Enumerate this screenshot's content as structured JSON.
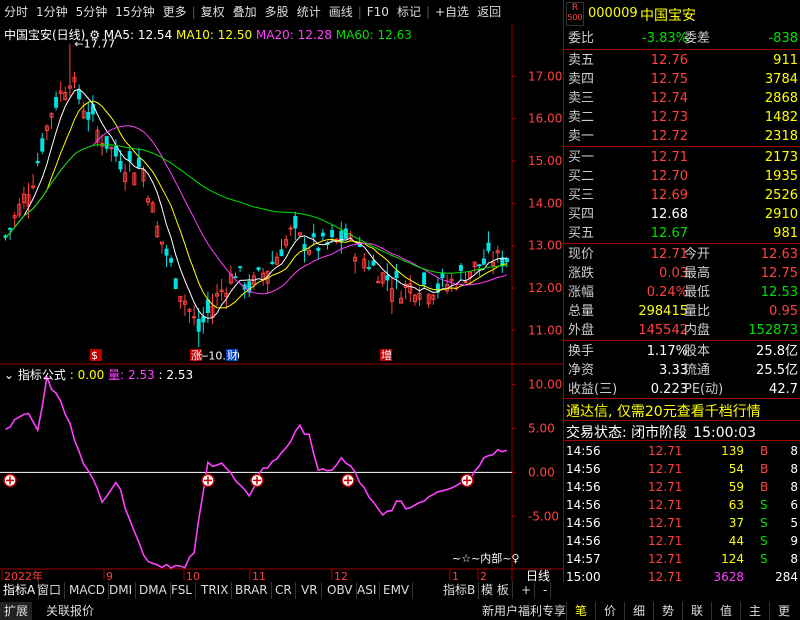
{
  "toolbar": {
    "items": [
      "分时",
      "1分钟",
      "5分钟",
      "15分钟",
      "更多",
      "复权",
      "叠加",
      "多股",
      "统计",
      "画线",
      "F10",
      "标记",
      "+自选",
      "返回"
    ]
  },
  "chart_header": {
    "title": "中国宝安(日线)",
    "ma5": "MA5: 12.54",
    "ma10": "MA10: 12.50",
    "ma20": "MA20: 12.28",
    "ma60": "MA60: 12.63"
  },
  "indicator_header": {
    "name": "指标公式",
    "v1": ": 0.00",
    "v2": "量: 2.53",
    "v3": ": 2.53"
  },
  "chart_data": [
    {
      "type": "line",
      "name": "price",
      "yaxis_ticks": [
        "17.00",
        "16.00",
        "15.00",
        "14.00",
        "13.00",
        "12.00",
        "11.00"
      ],
      "ylim": [
        10.6,
        17.77
      ],
      "annotations": [
        "17.77",
        "10.60"
      ],
      "markers": [
        "$",
        "涨",
        "财",
        "增"
      ]
    },
    {
      "type": "line",
      "name": "indicator",
      "yaxis_ticks": [
        "10.00",
        "5.00",
        "0.00",
        "-5.00"
      ],
      "ylim": [
        -11,
        11
      ]
    }
  ],
  "date_axis": {
    "labels": [
      "2022年",
      "9",
      "10",
      "11",
      "12",
      "1",
      "2"
    ],
    "period": "日线"
  },
  "badge_r": "R",
  "badge_num": "500",
  "stock": {
    "code": "000009",
    "name": "中国宝安"
  },
  "weibi": {
    "label": "委比",
    "value": "-3.83%",
    "label2": "委差",
    "value2": "-838"
  },
  "asks": [
    {
      "label": "卖五",
      "price": "12.76",
      "vol": "911"
    },
    {
      "label": "卖四",
      "price": "12.75",
      "vol": "3784"
    },
    {
      "label": "卖三",
      "price": "12.74",
      "vol": "2868"
    },
    {
      "label": "卖二",
      "price": "12.73",
      "vol": "1482"
    },
    {
      "label": "卖一",
      "price": "12.72",
      "vol": "2318"
    }
  ],
  "bids": [
    {
      "label": "买一",
      "price": "12.71",
      "vol": "2173"
    },
    {
      "label": "买二",
      "price": "12.70",
      "vol": "1935"
    },
    {
      "label": "买三",
      "price": "12.69",
      "vol": "2526"
    },
    {
      "label": "买四",
      "price": "12.68",
      "vol": "2910"
    },
    {
      "label": "买五",
      "price": "12.67",
      "vol": "981"
    }
  ],
  "quote": [
    {
      "l1": "现价",
      "v1": "12.71",
      "l2": "今开",
      "v2": "12.63"
    },
    {
      "l1": "涨跌",
      "v1": "0.03",
      "l2": "最高",
      "v2": "12.75"
    },
    {
      "l1": "涨幅",
      "v1": "0.24%",
      "l2": "最低",
      "v2": "12.53"
    },
    {
      "l1": "总量",
      "v1": "298415",
      "l2": "量比",
      "v2": "0.95"
    },
    {
      "l1": "外盘",
      "v1": "145542",
      "l2": "内盘",
      "v2": "152873"
    }
  ],
  "stats": [
    {
      "l1": "换手",
      "v1": "1.17%",
      "l2": "股本",
      "v2": "25.8亿"
    },
    {
      "l1": "净资",
      "v1": "3.33",
      "l2": "流通",
      "v2": "25.5亿"
    },
    {
      "l1": "收益(三)",
      "v1": "0.223",
      "l2": "PE(动)",
      "v2": "42.7"
    }
  ],
  "promo": "通达信, 仅需20元查看千档行情",
  "trade_status": {
    "label": "交易状态: 闭市阶段",
    "time": "15:00:03"
  },
  "ticks": [
    {
      "time": "14:56",
      "price": "12.71",
      "vol": "139",
      "side": "B",
      "n": "8"
    },
    {
      "time": "14:56",
      "price": "12.71",
      "vol": "54",
      "side": "B",
      "n": "8"
    },
    {
      "time": "14:56",
      "price": "12.71",
      "vol": "59",
      "side": "B",
      "n": "8"
    },
    {
      "time": "14:56",
      "price": "12.71",
      "vol": "63",
      "side": "S",
      "n": "6"
    },
    {
      "time": "14:56",
      "price": "12.71",
      "vol": "37",
      "side": "S",
      "n": "5"
    },
    {
      "time": "14:56",
      "price": "12.71",
      "vol": "44",
      "side": "S",
      "n": "9"
    },
    {
      "time": "14:57",
      "price": "12.71",
      "vol": "124",
      "side": "S",
      "n": "8"
    },
    {
      "time": "15:00",
      "price": "12.71",
      "vol": "3628",
      "side": "",
      "n": "284"
    }
  ],
  "indicator_tabs": [
    "指标A",
    "窗口",
    "MACD",
    "DMI",
    "DMA",
    "FSL",
    "TRIX",
    "BRAR",
    "CR",
    "VR",
    "OBV",
    "ASI",
    "EMV"
  ],
  "indicator_b": "指标B",
  "module": "模 板",
  "plus": "+",
  "minus": "-",
  "bottom_left": [
    "扩展",
    "关联报价"
  ],
  "bottom_center": "新用户福利专享",
  "bottom_right_tabs": [
    "笔",
    "价",
    "细",
    "势",
    "联",
    "值",
    "主",
    "更"
  ],
  "inner_label": "~☆~内部~♀",
  "colors": {
    "up": "#ff4040",
    "down": "#00e000",
    "ma5": "#ffffff",
    "ma10": "#ffff00",
    "ma20": "#ff40ff",
    "ma60": "#00e000",
    "ind": "#ff40ff"
  }
}
